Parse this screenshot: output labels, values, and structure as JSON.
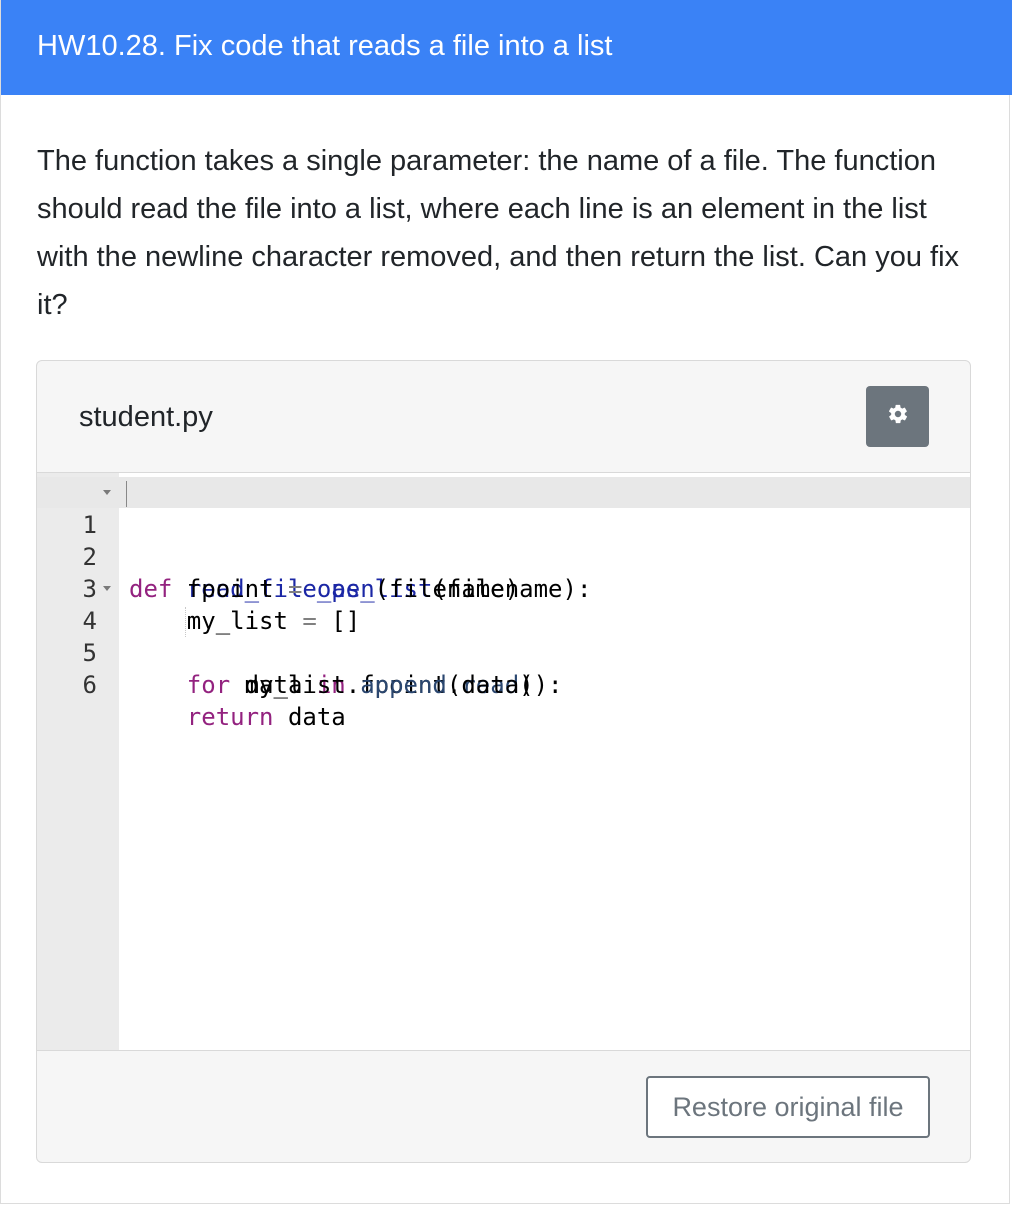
{
  "header": {
    "title": "HW10.28. Fix code that reads a file into a list"
  },
  "prompt": {
    "text": "The function takes a single parameter: the name of a file. The function should read the file into a list, where each line is an element in the list with the newline character removed, and then return the list. Can you fix it?"
  },
  "editor": {
    "file_name": "student.py",
    "settings_icon": "gear-icon",
    "lines": [
      {
        "number": "1",
        "text": "def read_file_as_list(filename):"
      },
      {
        "number": "2",
        "text": "    fpoint = open(filename)"
      },
      {
        "number": "3",
        "text": "    my_list = []"
      },
      {
        "number": "4",
        "text": "    for data in fpoint.read():"
      },
      {
        "number": "5",
        "text": "        my_list.append(data)"
      },
      {
        "number": "6",
        "text": "    return data"
      }
    ],
    "restore_label": "Restore original file"
  },
  "colors": {
    "header_bg": "#3a82f6",
    "keyword": "#93227f",
    "function_name": "#1b27a5",
    "button_gray": "#6c757d"
  }
}
